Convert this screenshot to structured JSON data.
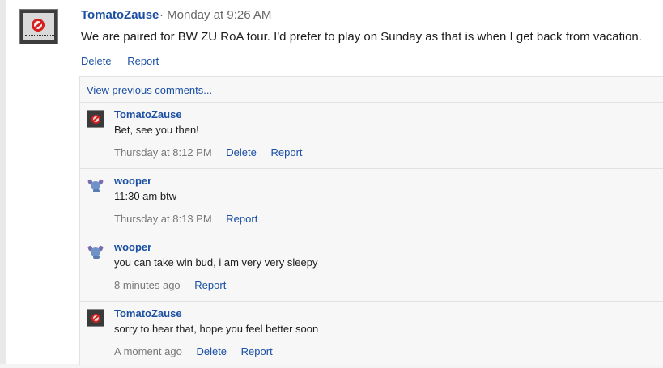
{
  "post": {
    "author": "TomatoZause",
    "time": "· Monday at 9:26 AM",
    "text": "We are paired for BW ZU RoA tour. I'd prefer to play on Sunday as that is when I get back from vacation.",
    "actions": {
      "delete": "Delete",
      "report": "Report"
    }
  },
  "comments": {
    "view_previous": "View previous comments...",
    "items": [
      {
        "author": "TomatoZause",
        "avatar": "no-sign-avatar",
        "text": "Bet, see you then!",
        "time": "Thursday at 8:12 PM",
        "delete": "Delete",
        "report": "Report"
      },
      {
        "author": "wooper",
        "avatar": "wooper-avatar",
        "text": "11:30 am btw",
        "time": "Thursday at 8:13 PM",
        "report": "Report"
      },
      {
        "author": "wooper",
        "avatar": "wooper-avatar",
        "text": "you can take win bud, i am very very sleepy",
        "time": "8 minutes ago",
        "report": "Report"
      },
      {
        "author": "TomatoZause",
        "avatar": "no-sign-avatar",
        "text": "sorry to hear that, hope you feel better soon",
        "time": "A moment ago",
        "delete": "Delete",
        "report": "Report"
      }
    ]
  },
  "colors": {
    "link": "#1a4fa3",
    "meta": "#777777",
    "panel": "#f7f7f7"
  }
}
